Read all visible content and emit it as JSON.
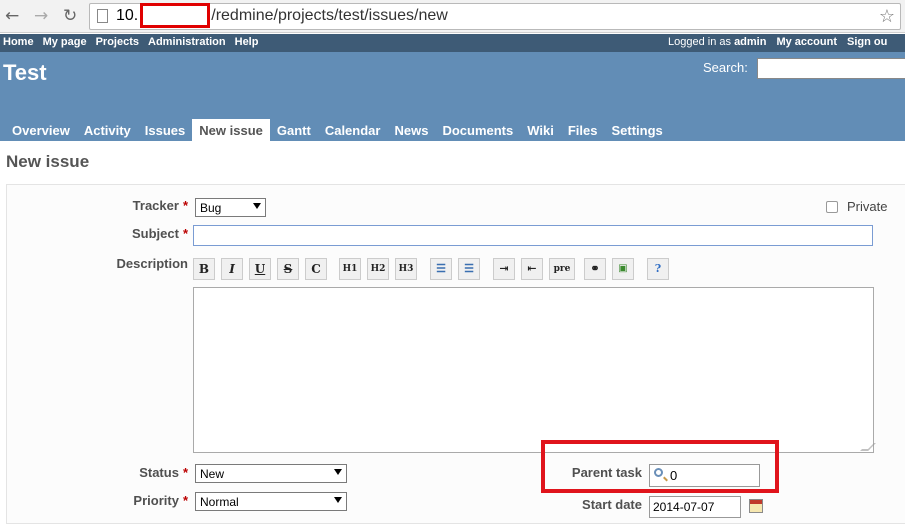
{
  "browser": {
    "back_icon": "arrow-left-icon",
    "forward_icon": "arrow-right-icon",
    "reload_icon": "reload-icon",
    "url_host": "10.",
    "url_path": "/redmine/projects/test/issues/new",
    "bookmark_icon": "star-icon"
  },
  "topmenu": {
    "left": [
      "Home",
      "My page",
      "Projects",
      "Administration",
      "Help"
    ],
    "logged_in_prefix": "Logged in as",
    "user": "admin",
    "my_account": "My account",
    "sign_out": "Sign ou"
  },
  "header": {
    "project_title": "Test",
    "search_label": "Search:"
  },
  "tabs": [
    "Overview",
    "Activity",
    "Issues",
    "New issue",
    "Gantt",
    "Calendar",
    "News",
    "Documents",
    "Wiki",
    "Files",
    "Settings"
  ],
  "selected_tab": "New issue",
  "page": {
    "title": "New issue"
  },
  "form": {
    "tracker_label": "Tracker",
    "tracker_value": "Bug",
    "private_label": "Private",
    "subject_label": "Subject",
    "description_label": "Description",
    "required_mark": "*",
    "toolbar": {
      "bold": "B",
      "italic": "I",
      "underline": "U",
      "strike": "S",
      "code": "C",
      "h1": "H1",
      "h2": "H2",
      "h3": "H3",
      "pre": "pre",
      "icons": [
        "unordered-list-icon",
        "ordered-list-icon",
        "indent-icon",
        "outdent-icon",
        "link-icon",
        "image-icon",
        "help-icon"
      ]
    },
    "status_label": "Status",
    "status_value": "New",
    "priority_label": "Priority",
    "priority_value": "Normal",
    "parent_task_label": "Parent task",
    "parent_task_value": "0",
    "start_date_label": "Start date",
    "start_date_value": "2014-07-07"
  },
  "colors": {
    "top_menu": "#3e5b76",
    "header": "#628db6",
    "highlight": "#e0141c",
    "required": "#bb0000"
  }
}
